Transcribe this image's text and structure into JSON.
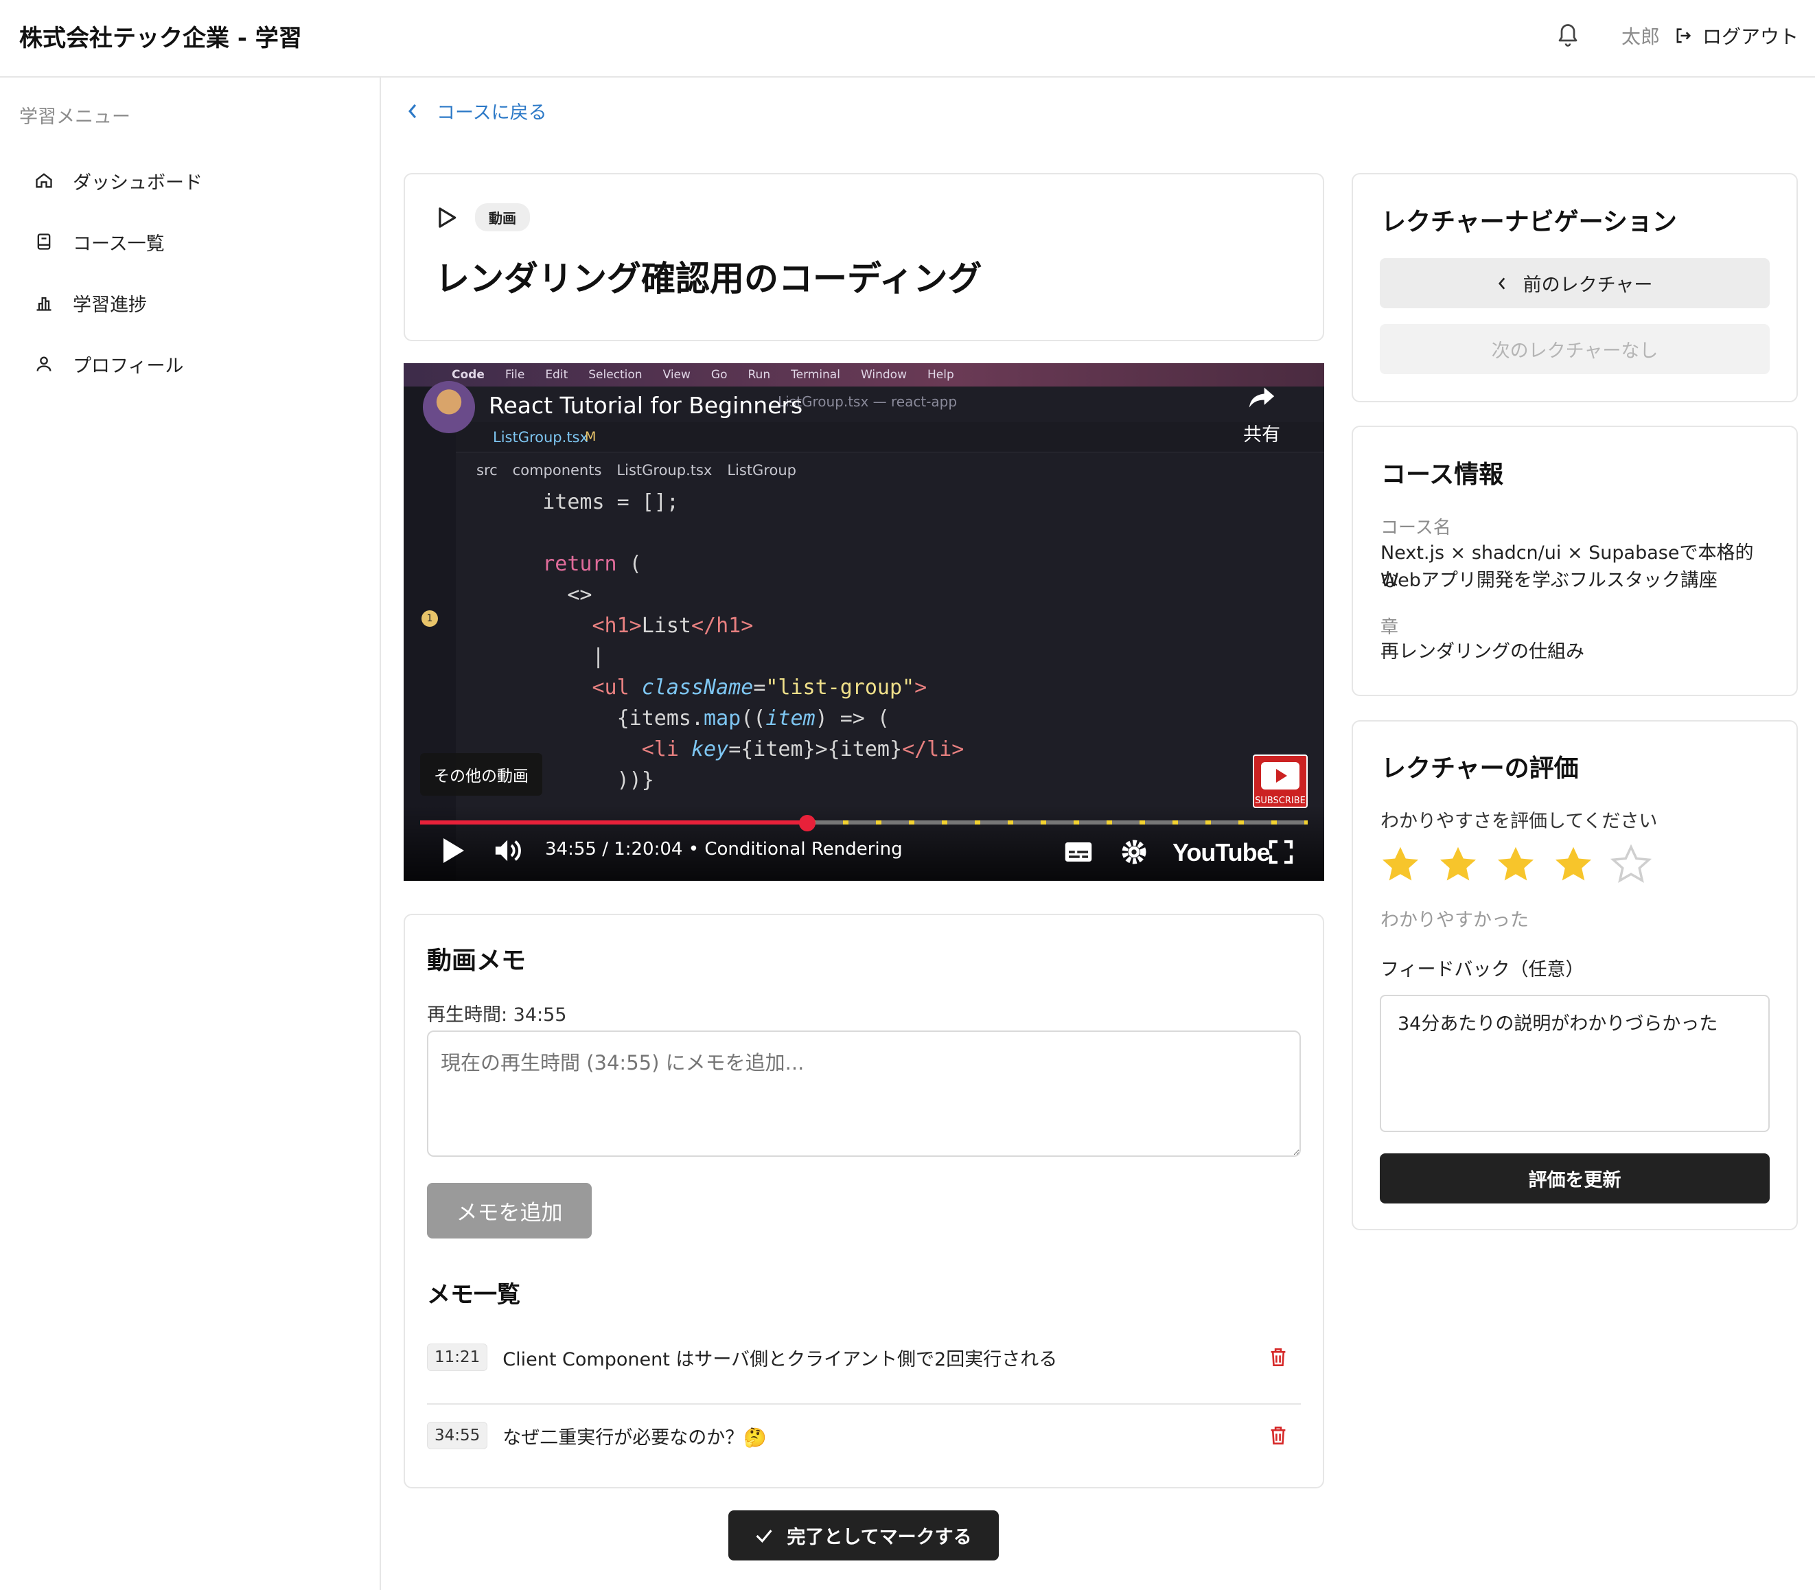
{
  "header": {
    "brand": "株式会社テック企業 - 学習",
    "user": "太郎",
    "logout_label": "ログアウト"
  },
  "sidebar": {
    "title": "学習メニュー",
    "items": [
      {
        "label": "ダッシュボード",
        "icon": "home-icon"
      },
      {
        "label": "コース一覧",
        "icon": "book-icon"
      },
      {
        "label": "学習進捗",
        "icon": "bar-chart-icon"
      },
      {
        "label": "プロフィール",
        "icon": "user-icon"
      }
    ]
  },
  "back_label": "コースに戻る",
  "lecture": {
    "badge": "動画",
    "title": "レンダリング確認用のコーディング"
  },
  "video": {
    "title": "React Tutorial for Beginners",
    "time": "34:55 / 1:20:04",
    "chapter": "Conditional Rendering",
    "more_videos": "その他の動画",
    "share_label": "共有",
    "brand": "YouTube",
    "subscribe": "SUBSCRIBE",
    "progress_fraction": 0.436,
    "editor": {
      "menu": [
        "Code",
        "File",
        "Edit",
        "Selection",
        "View",
        "Go",
        "Run",
        "Terminal",
        "Window",
        "Help"
      ],
      "window_title": "ListGroup.tsx — react-app",
      "tab": "ListGroup.tsx",
      "tab_status": "M",
      "breadcrumb": [
        "src",
        "components",
        "ListGroup.tsx",
        "ListGroup"
      ],
      "scm_badge": "1"
    }
  },
  "memo": {
    "heading": "動画メモ",
    "playback_label": "再生時間: 34:55",
    "placeholder": "現在の再生時間 (34:55) にメモを追加...",
    "add_button": "メモを追加",
    "list_heading": "メモ一覧",
    "items": [
      {
        "time": "11:21",
        "text": "Client Component はサーバ側とクライアント側で2回実行される"
      },
      {
        "time": "34:55",
        "text": "なぜ二重実行が必要なのか？🤔"
      }
    ]
  },
  "complete_button": "完了としてマークする",
  "navigation": {
    "heading": "レクチャーナビゲーション",
    "prev": "前のレクチャー",
    "next": "次のレクチャーなし"
  },
  "course_info": {
    "heading": "コース情報",
    "course_label": "コース名",
    "course_name_line1": "Next.js × shadcn/ui × Supabaseで本格的な",
    "course_name_line2": "Webアプリ開発を学ぶフルスタック講座",
    "chapter_label": "章",
    "chapter": "再レンダリングの仕組み"
  },
  "rating": {
    "heading": "レクチャーの評価",
    "prompt": "わかりやすさを評価してください",
    "value": 4,
    "max": 5,
    "value_label": "わかりやすかった",
    "feedback_label": "フィードバック（任意）",
    "feedback_value": "34分あたりの説明がわかりづらかった",
    "submit": "評価を更新"
  }
}
